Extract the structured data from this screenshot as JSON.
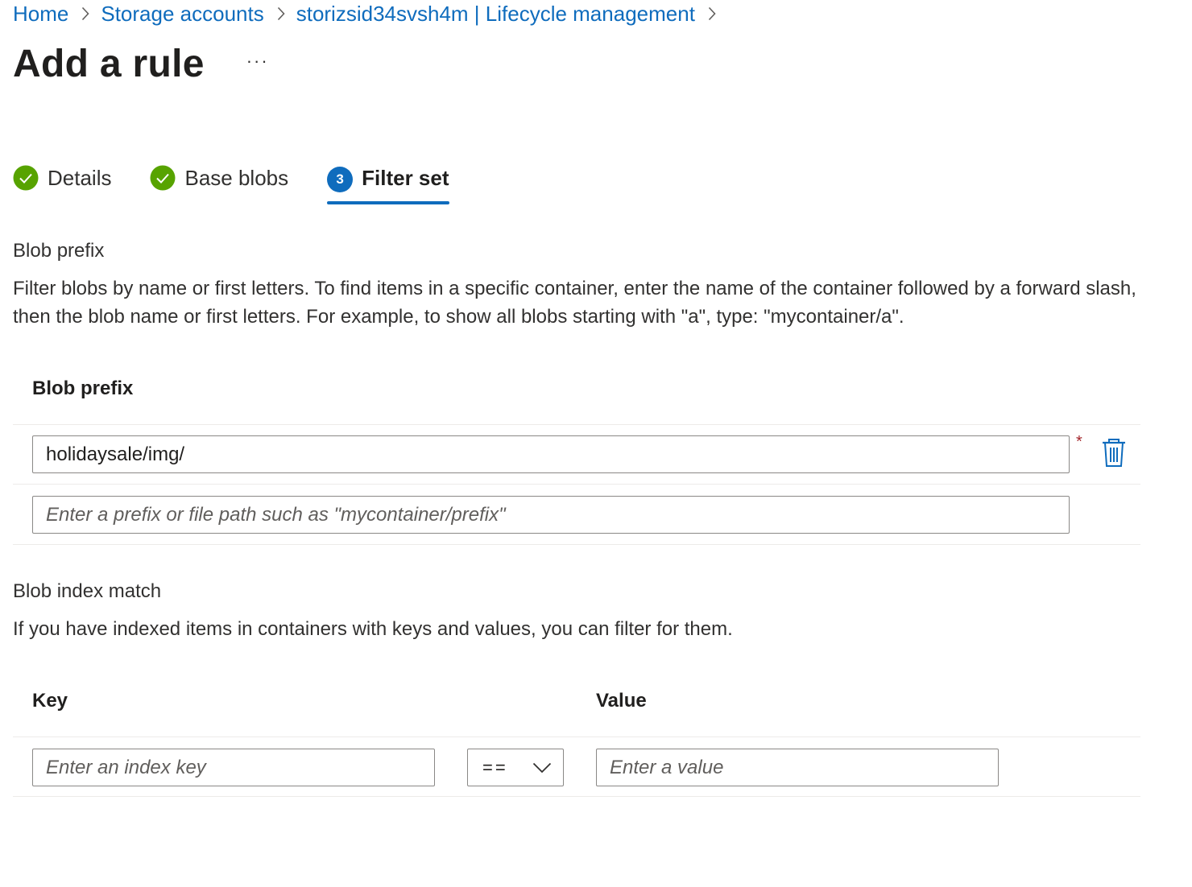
{
  "breadcrumb": {
    "items": [
      {
        "label": "Home"
      },
      {
        "label": "Storage accounts"
      },
      {
        "label": "storizsid34svsh4m | Lifecycle management"
      }
    ]
  },
  "header": {
    "title": "Add a rule",
    "more_label": "···"
  },
  "tabs": [
    {
      "label": "Details",
      "state": "complete",
      "icon": "checkmark-circle-icon"
    },
    {
      "label": "Base blobs",
      "state": "complete",
      "icon": "checkmark-circle-icon"
    },
    {
      "label": "Filter set",
      "state": "active",
      "step": "3"
    }
  ],
  "blob_prefix_section": {
    "heading": "Blob prefix",
    "description": "Filter blobs by name or first letters. To find items in a specific container, enter the name of the container followed by a forward slash, then the blob name or first letters. For example, to show all blobs starting with \"a\", type: \"mycontainer/a\".",
    "column_header": "Blob prefix",
    "rows": [
      {
        "value": "holidaysale/img/",
        "placeholder": ""
      },
      {
        "value": "",
        "placeholder": "Enter a prefix or file path such as \"mycontainer/prefix\""
      }
    ],
    "required_marker": "*",
    "delete_icon": "trash-icon"
  },
  "blob_index_section": {
    "heading": "Blob index match",
    "description": "If you have indexed items in containers with keys and values, you can filter for them.",
    "key_header": "Key",
    "value_header": "Value",
    "key_placeholder": "Enter an index key",
    "operator": "==",
    "value_placeholder": "Enter a value"
  },
  "colors": {
    "accent": "#0f6cbd",
    "success": "#57a300",
    "required": "#a4262c"
  }
}
